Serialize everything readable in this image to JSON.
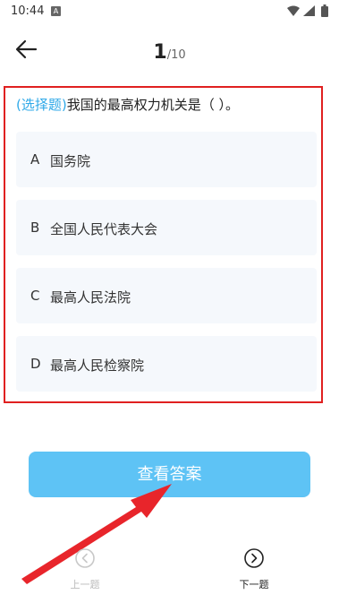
{
  "status_bar": {
    "time": "10:44",
    "notification_icon": "a-notification-icon",
    "icons": [
      "wifi-icon",
      "signal-icon",
      "battery-icon"
    ]
  },
  "header": {
    "back_icon": "arrow-left-icon",
    "current": "1",
    "total": "/10"
  },
  "question": {
    "type_label": "(选择题)",
    "text": "我国的最高权力机关是（ ）。",
    "options": [
      {
        "letter": "A",
        "text": "国务院"
      },
      {
        "letter": "B",
        "text": "全国人民代表大会"
      },
      {
        "letter": "C",
        "text": "最高人民法院"
      },
      {
        "letter": "D",
        "text": "最高人民检察院"
      }
    ]
  },
  "actions": {
    "view_answer_label": "查看答案"
  },
  "bottom_nav": {
    "prev_label": "上一题",
    "next_label": "下一题",
    "prev_icon": "chevron-left-circle-icon",
    "next_icon": "chevron-right-circle-icon"
  },
  "colors": {
    "accent": "#5ec3f5",
    "question_type": "#2fa9e8",
    "highlight_border": "#e02020",
    "annotation_arrow": "#e8252b"
  }
}
